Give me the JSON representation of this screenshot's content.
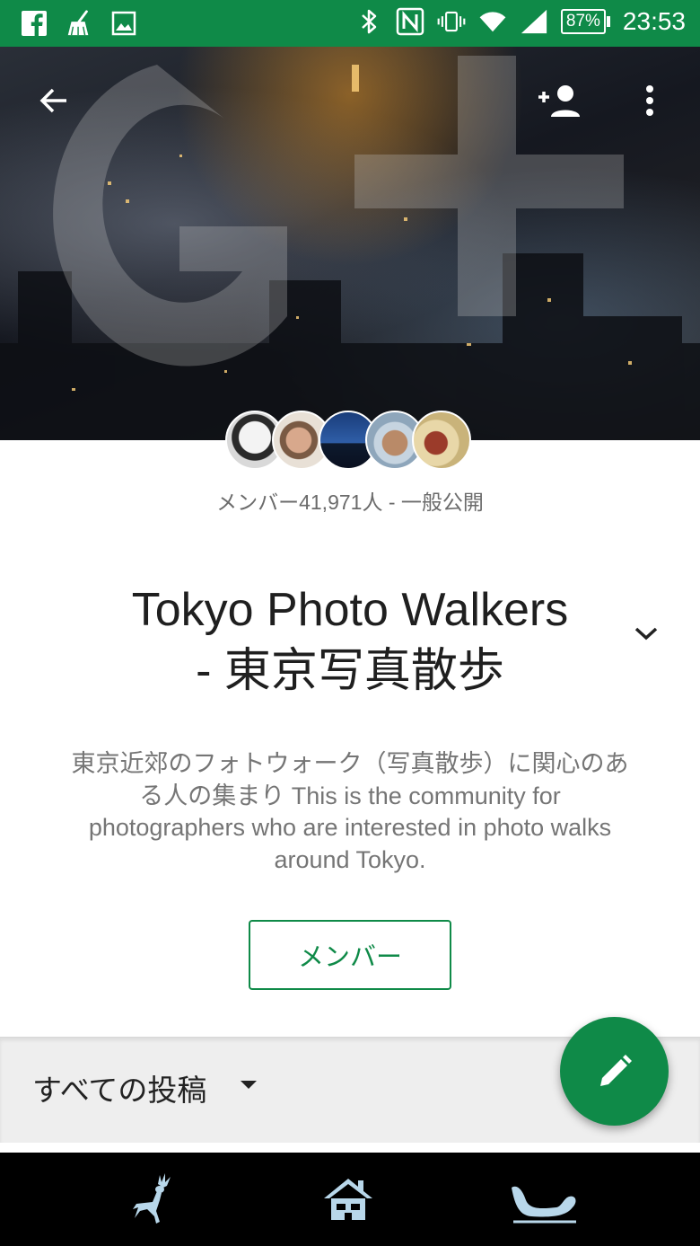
{
  "status_bar": {
    "left_icons": [
      "facebook-icon",
      "cleaner-icon",
      "gallery-icon"
    ],
    "right_icons": [
      "bluetooth-icon",
      "nfc-icon",
      "vibrate-icon",
      "wifi-icon",
      "signal-icon"
    ],
    "battery": "87%",
    "time": "23:53",
    "color": "#0f8a48"
  },
  "cover": {
    "back_icon": "arrow-back-icon",
    "add_member_icon": "person-add-icon",
    "menu_icon": "more-vert-icon"
  },
  "community": {
    "member_info": "メンバー41,971人 - 一般公開",
    "title_line1": "Tokyo Photo Walkers",
    "title_line2": "- 東京写真散歩",
    "description": "東京近郊のフォトウォーク（写真散歩）に関心のある人の集まり This is the community for photographers who are interested in photo walks around Tokyo.",
    "member_button": "メンバー",
    "accent_color": "#0f8a48"
  },
  "filter": {
    "label": "すべての投稿"
  },
  "fab": {
    "icon": "edit-pencil-icon"
  },
  "nav_bar": {
    "buttons": [
      "deer-icon",
      "home-icon",
      "sleigh-icon"
    ],
    "icon_color": "#b8d7ea"
  }
}
